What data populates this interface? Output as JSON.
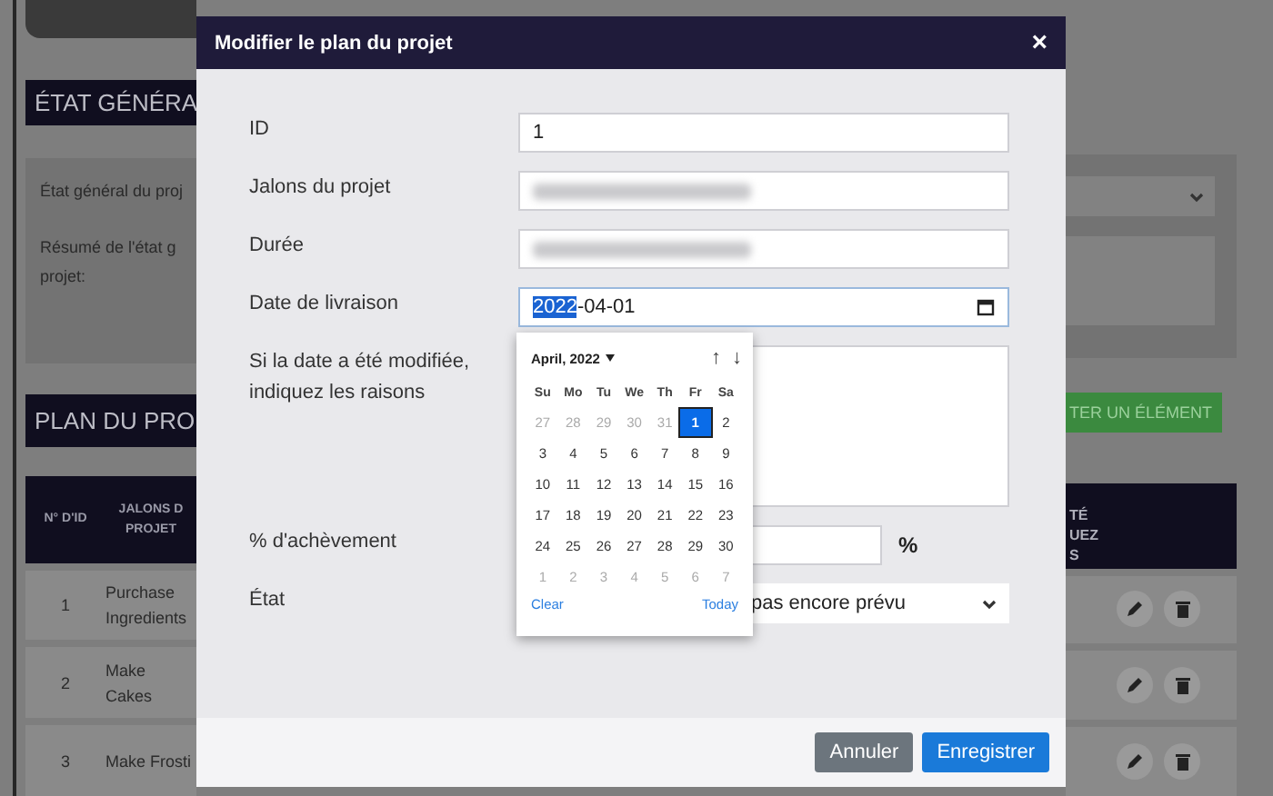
{
  "background": {
    "status_title": "ÉTAT GÉNÉRA",
    "status_label": "État général du proj",
    "summary_label": [
      "Résumé de l'état g",
      "projet:"
    ],
    "plan_title": "PLAN DU PRO",
    "add_button": "TER UN ÉLÉMENT",
    "table": {
      "columns": [
        [
          "N° D'ID"
        ],
        [
          "JALONS D",
          "PROJET"
        ],
        [
          "TÉ",
          "UEZ",
          "S"
        ]
      ],
      "rows": [
        {
          "id": "1",
          "milestone": "Purchase Ingredients"
        },
        {
          "id": "2",
          "milestone": "Make Cakes"
        },
        {
          "id": "3",
          "milestone": "Make Frosti"
        }
      ]
    }
  },
  "dialog": {
    "title": "Modifier le plan du projet",
    "close": "×",
    "fields": [
      {
        "kind": "text",
        "label": "ID",
        "value": "1"
      },
      {
        "kind": "redacted",
        "label": "Jalons du projet"
      },
      {
        "kind": "redacted",
        "label": "Durée"
      },
      {
        "kind": "date",
        "label": "Date de livraison",
        "value": [
          {
            "text": "2022",
            "selected": true
          },
          {
            "text": "-04-01",
            "selected": false
          }
        ]
      },
      {
        "kind": "textarea",
        "label": "Si la date a été modifiée, indiquez les raisons"
      },
      {
        "kind": "percent",
        "label": "% d'achèvement",
        "unit": "%"
      },
      {
        "kind": "select",
        "label": "État",
        "value": "pas encore prévu"
      }
    ],
    "buttons": [
      {
        "label": "Annuler",
        "kind": "secondary"
      },
      {
        "label": "Enregistrer",
        "kind": "primary"
      }
    ]
  },
  "calendar": {
    "month": "April, 2022",
    "prev": "↑",
    "next": "↓",
    "weekdays": [
      "Su",
      "Mo",
      "Tu",
      "We",
      "Th",
      "Fr",
      "Sa"
    ],
    "days": [
      {
        "label": "27",
        "muted": true,
        "selected": false
      },
      {
        "label": "28",
        "muted": true,
        "selected": false
      },
      {
        "label": "29",
        "muted": true,
        "selected": false
      },
      {
        "label": "30",
        "muted": true,
        "selected": false
      },
      {
        "label": "31",
        "muted": true,
        "selected": false
      },
      {
        "label": "1",
        "muted": false,
        "selected": true
      },
      {
        "label": "2",
        "muted": false,
        "selected": false
      },
      {
        "label": "3",
        "muted": false,
        "selected": false
      },
      {
        "label": "4",
        "muted": false,
        "selected": false
      },
      {
        "label": "5",
        "muted": false,
        "selected": false
      },
      {
        "label": "6",
        "muted": false,
        "selected": false
      },
      {
        "label": "7",
        "muted": false,
        "selected": false
      },
      {
        "label": "8",
        "muted": false,
        "selected": false
      },
      {
        "label": "9",
        "muted": false,
        "selected": false
      },
      {
        "label": "10",
        "muted": false,
        "selected": false
      },
      {
        "label": "11",
        "muted": false,
        "selected": false
      },
      {
        "label": "12",
        "muted": false,
        "selected": false
      },
      {
        "label": "13",
        "muted": false,
        "selected": false
      },
      {
        "label": "14",
        "muted": false,
        "selected": false
      },
      {
        "label": "15",
        "muted": false,
        "selected": false
      },
      {
        "label": "16",
        "muted": false,
        "selected": false
      },
      {
        "label": "17",
        "muted": false,
        "selected": false
      },
      {
        "label": "18",
        "muted": false,
        "selected": false
      },
      {
        "label": "19",
        "muted": false,
        "selected": false
      },
      {
        "label": "20",
        "muted": false,
        "selected": false
      },
      {
        "label": "21",
        "muted": false,
        "selected": false
      },
      {
        "label": "22",
        "muted": false,
        "selected": false
      },
      {
        "label": "23",
        "muted": false,
        "selected": false
      },
      {
        "label": "24",
        "muted": false,
        "selected": false
      },
      {
        "label": "25",
        "muted": false,
        "selected": false
      },
      {
        "label": "26",
        "muted": false,
        "selected": false
      },
      {
        "label": "27",
        "muted": false,
        "selected": false
      },
      {
        "label": "28",
        "muted": false,
        "selected": false
      },
      {
        "label": "29",
        "muted": false,
        "selected": false
      },
      {
        "label": "30",
        "muted": false,
        "selected": false
      },
      {
        "label": "1",
        "muted": true,
        "selected": false
      },
      {
        "label": "2",
        "muted": true,
        "selected": false
      },
      {
        "label": "3",
        "muted": true,
        "selected": false
      },
      {
        "label": "4",
        "muted": true,
        "selected": false
      },
      {
        "label": "5",
        "muted": true,
        "selected": false
      },
      {
        "label": "6",
        "muted": true,
        "selected": false
      },
      {
        "label": "7",
        "muted": true,
        "selected": false
      }
    ],
    "clear": "Clear",
    "today": "Today"
  }
}
